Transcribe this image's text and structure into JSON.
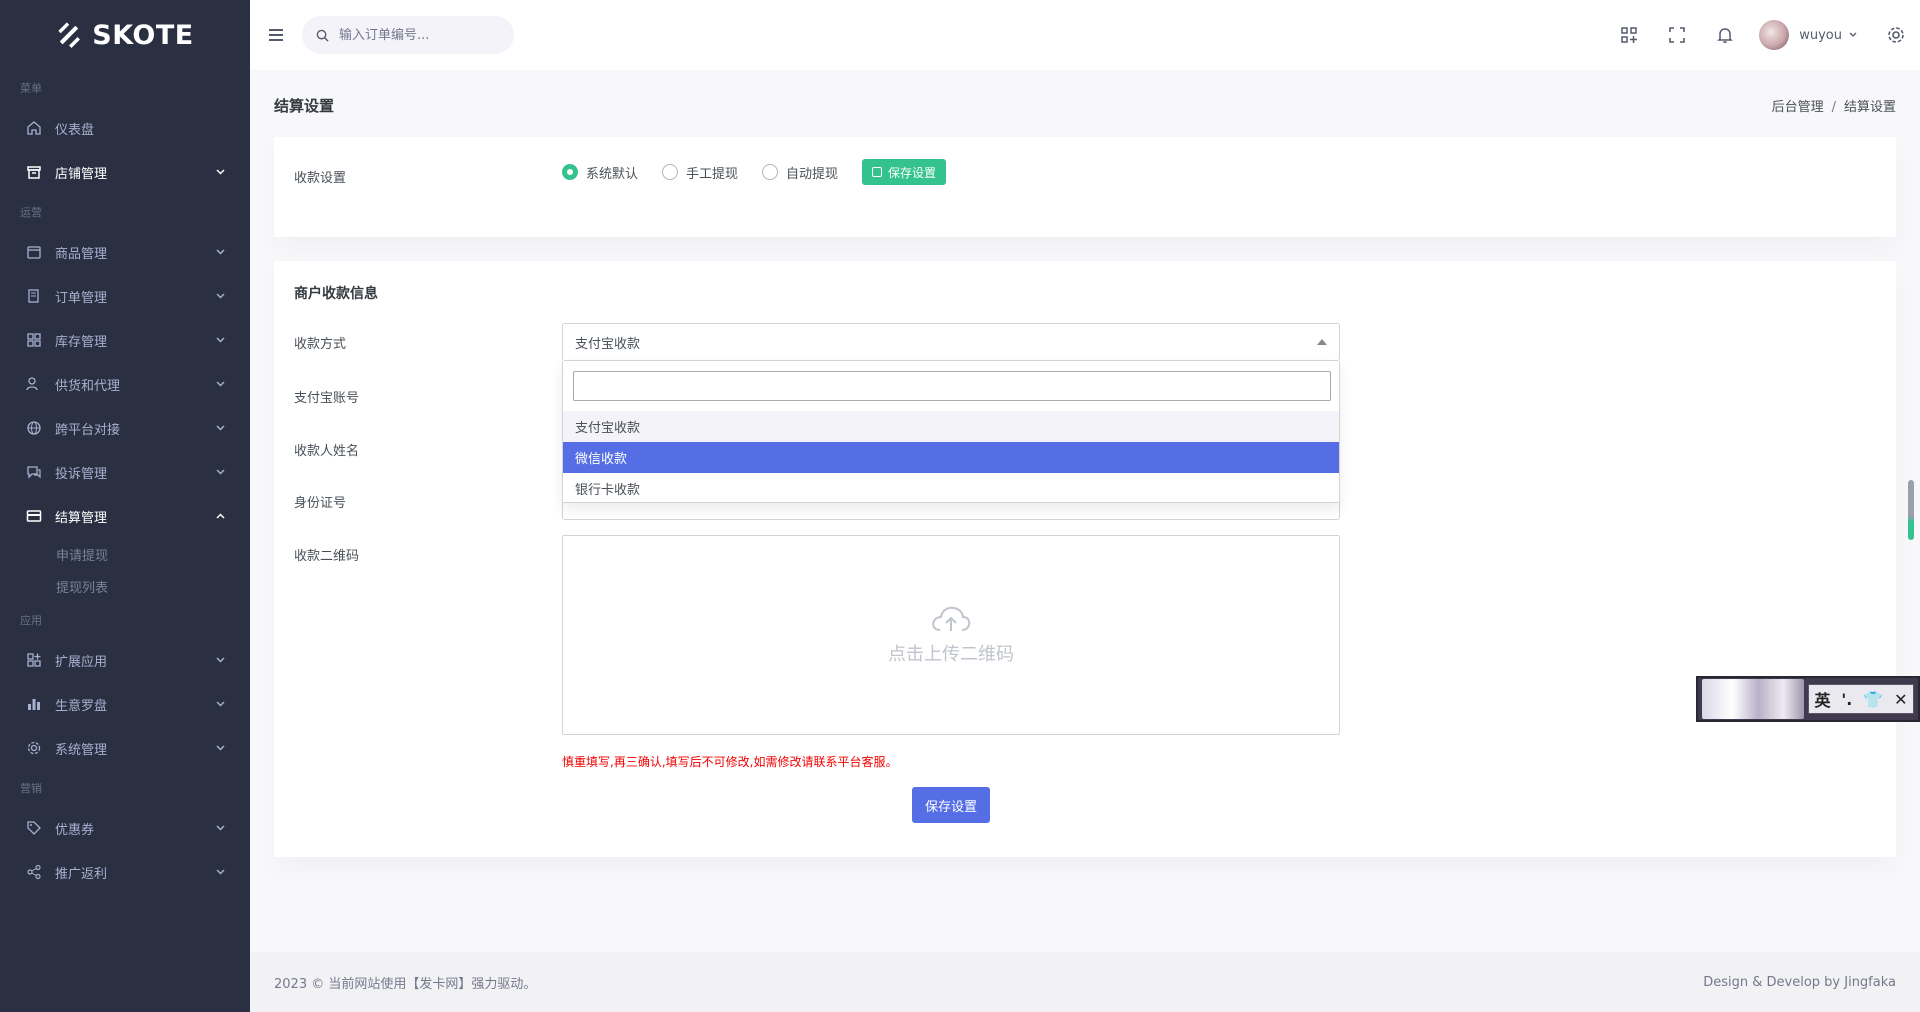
{
  "brand": {
    "name": "SKOTE"
  },
  "sidebar": {
    "sections": [
      {
        "title": "菜单",
        "items": [
          {
            "label": "仪表盘",
            "icon": "home-icon",
            "has_chevron": false
          },
          {
            "label": "店铺管理",
            "icon": "store-icon",
            "has_chevron": true,
            "active": true
          }
        ]
      },
      {
        "title": "运营",
        "items": [
          {
            "label": "商品管理",
            "icon": "box-icon",
            "has_chevron": true
          },
          {
            "label": "订单管理",
            "icon": "receipt-icon",
            "has_chevron": true
          },
          {
            "label": "库存管理",
            "icon": "grid-icon",
            "has_chevron": true
          },
          {
            "label": "供货和代理",
            "icon": "users-icon",
            "has_chevron": true
          },
          {
            "label": "跨平台对接",
            "icon": "globe-icon",
            "has_chevron": true
          },
          {
            "label": "投诉管理",
            "icon": "chat-icon",
            "has_chevron": true
          },
          {
            "label": "结算管理",
            "icon": "card-icon",
            "has_chevron": true,
            "active": true,
            "expanded": true,
            "children": [
              "申请提现",
              "提现列表"
            ]
          }
        ]
      },
      {
        "title": "应用",
        "items": [
          {
            "label": "扩展应用",
            "icon": "apps-icon",
            "has_chevron": true
          },
          {
            "label": "生意罗盘",
            "icon": "bar-chart-icon",
            "has_chevron": true
          },
          {
            "label": "系统管理",
            "icon": "gear-icon",
            "has_chevron": true
          }
        ]
      },
      {
        "title": "营销",
        "items": [
          {
            "label": "优惠券",
            "icon": "tag-icon",
            "has_chevron": true
          },
          {
            "label": "推广返利",
            "icon": "share-icon",
            "has_chevron": true
          }
        ]
      }
    ]
  },
  "topbar": {
    "search_placeholder": "输入订单编号...",
    "username": "wuyou"
  },
  "page": {
    "title": "结算设置",
    "breadcrumb": [
      "后台管理",
      "结算设置"
    ]
  },
  "settle_card": {
    "label": "收款设置",
    "radios": [
      {
        "label": "系统默认",
        "checked": true
      },
      {
        "label": "手工提现",
        "checked": false
      },
      {
        "label": "自动提现",
        "checked": false
      }
    ],
    "save_label": "保存设置"
  },
  "merchant_card": {
    "title": "商户收款信息",
    "fields": {
      "method": "收款方式",
      "alipay_account": "支付宝账号",
      "payee_name": "收款人姓名",
      "id_number": "身份证号",
      "qr_code": "收款二维码"
    },
    "method_selected": "支付宝收款",
    "dropdown_options": [
      "支付宝收款",
      "微信收款",
      "银行卡收款"
    ],
    "dropdown_highlight": "微信收款",
    "upload_text": "点击上传二维码",
    "warning": "慎重填写,再三确认,填写后不可修改,如需修改请联系平台客服。",
    "save_label": "保存设置"
  },
  "footer": {
    "left": "2023 © 当前网站使用【发卡网】强力驱动。",
    "right": "Design & Develop by Jingfaka"
  },
  "widget": {
    "glyphs": [
      "英",
      "'.",
      "👕",
      "✕"
    ]
  },
  "colors": {
    "sidebar": "#2a3042",
    "primary": "#556ee6",
    "success": "#34c38f",
    "danger": "#f10000"
  }
}
